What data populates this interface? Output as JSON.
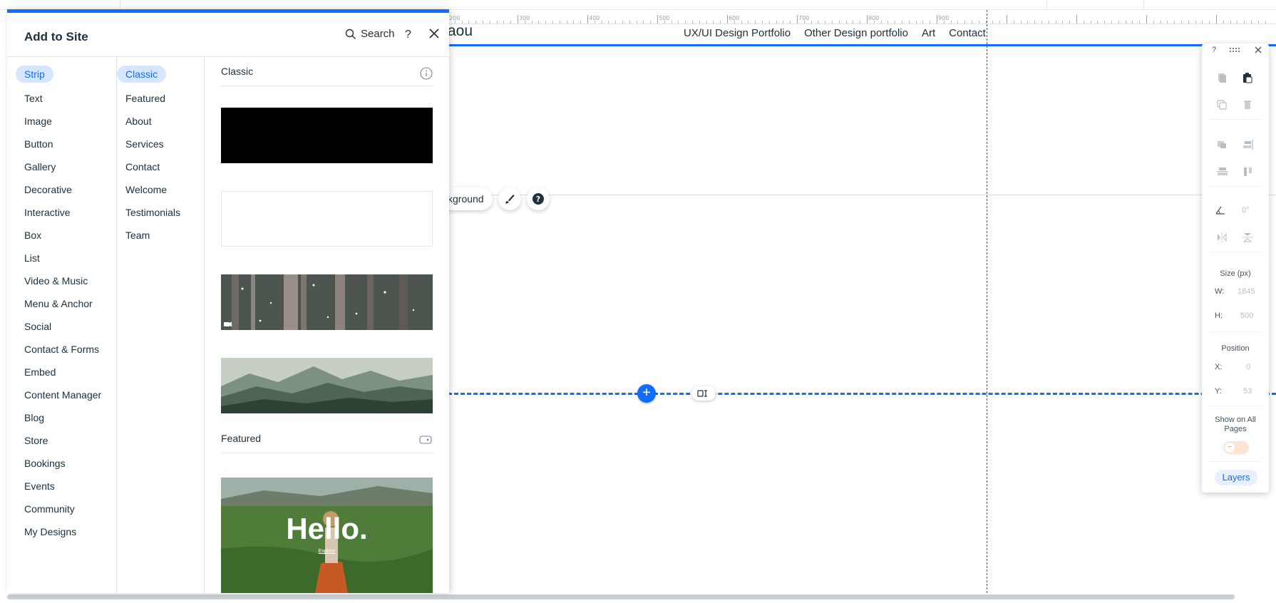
{
  "panel": {
    "title": "Add to Site",
    "search_label": "Search",
    "help_label": "?",
    "categories": [
      {
        "label": "Strip",
        "selected": true
      },
      {
        "label": "Text"
      },
      {
        "label": "Image"
      },
      {
        "label": "Button"
      },
      {
        "label": "Gallery"
      },
      {
        "label": "Decorative"
      },
      {
        "label": "Interactive"
      },
      {
        "label": "Box"
      },
      {
        "label": "List"
      },
      {
        "label": "Video & Music"
      },
      {
        "label": "Menu & Anchor"
      },
      {
        "label": "Social"
      },
      {
        "label": "Contact & Forms"
      },
      {
        "label": "Embed"
      },
      {
        "label": "Content Manager"
      },
      {
        "label": "Blog"
      },
      {
        "label": "Store"
      },
      {
        "label": "Bookings"
      },
      {
        "label": "Events"
      },
      {
        "label": "Community"
      },
      {
        "label": "My Designs"
      }
    ],
    "subcategories": [
      {
        "label": "Classic",
        "selected": true
      },
      {
        "label": "Featured"
      },
      {
        "label": "About"
      },
      {
        "label": "Services"
      },
      {
        "label": "Contact"
      },
      {
        "label": "Welcome"
      },
      {
        "label": "Testimonials"
      },
      {
        "label": "Team"
      }
    ],
    "sections": {
      "classic": "Classic",
      "featured": "Featured"
    },
    "featured_preview": {
      "headline": "Hello.",
      "sub": "Explore"
    }
  },
  "site": {
    "logo_text": "aou",
    "nav": [
      "UX/UI Design Portfolio",
      "Other Design portfolio",
      "Art",
      "Contact"
    ]
  },
  "strip_toolbar": {
    "background_label": "kground"
  },
  "ruler": {
    "labels": [
      "200",
      "300",
      "400",
      "500",
      "600",
      "700",
      "800",
      "900"
    ]
  },
  "props": {
    "help": "?",
    "rotation_value": "0°",
    "size_label": "Size (px)",
    "w_label": "W:",
    "w_value": "1845",
    "h_label": "H:",
    "h_value": "500",
    "position_label": "Position",
    "x_label": "X:",
    "x_value": "0",
    "y_label": "Y:",
    "y_value": "53",
    "show_all_pages_label": "Show on All Pages",
    "show_all_pages_on": false,
    "layers_label": "Layers"
  },
  "colors": {
    "accent": "#116dff",
    "selected_bg": "#d6e6fe",
    "text": "#20303c"
  }
}
